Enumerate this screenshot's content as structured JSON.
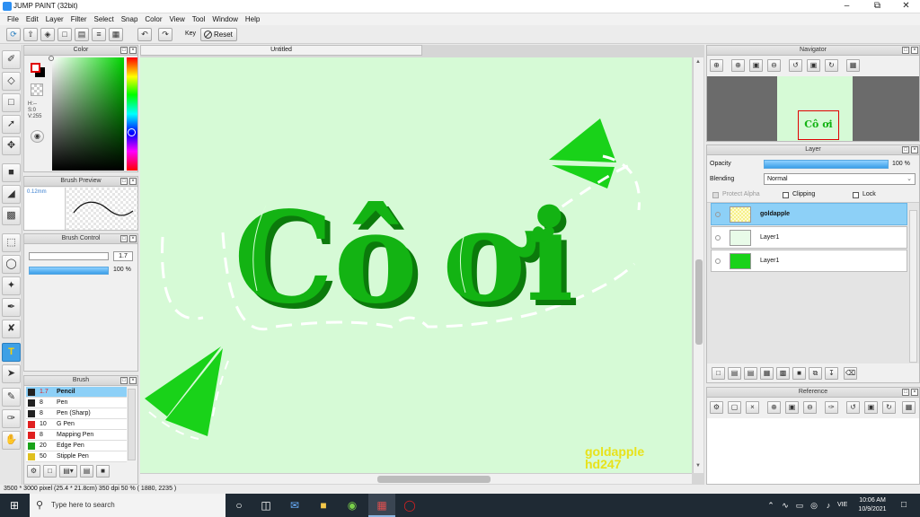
{
  "app": {
    "title": "JUMP PAINT (32bit)"
  },
  "menu": [
    "File",
    "Edit",
    "Layer",
    "Filter",
    "Select",
    "Snap",
    "Color",
    "View",
    "Tool",
    "Window",
    "Help"
  ],
  "toolbar": {
    "key_label": "Key",
    "reset_label": "Reset"
  },
  "color_panel": {
    "title": "Color",
    "hsv_h": "H:--",
    "hsv_s": "S:0",
    "hsv_v": "V:255",
    "fg_color": "#ffffff",
    "bg_color": "#000000"
  },
  "brush_preview": {
    "title": "Brush Preview",
    "size_text": "0.12mm"
  },
  "brush_control": {
    "title": "Brush Control",
    "size_value": "1.7",
    "opacity_value": "100 %"
  },
  "brush_panel": {
    "title": "Brush",
    "items": [
      {
        "size": "1.7",
        "name": "Pencil",
        "color": "#222222"
      },
      {
        "size": "8",
        "name": "Pen",
        "color": "#222222"
      },
      {
        "size": "8",
        "name": "Pen (Sharp)",
        "color": "#222222"
      },
      {
        "size": "10",
        "name": "G Pen",
        "color": "#e02020"
      },
      {
        "size": "8",
        "name": "Mapping Pen",
        "color": "#e02020"
      },
      {
        "size": "20",
        "name": "Edge Pen",
        "color": "#1aa31a"
      },
      {
        "size": "50",
        "name": "Stipple Pen",
        "color": "#e0c020"
      }
    ]
  },
  "document": {
    "tab_title": "Untitled",
    "art_text_1": "Cô",
    "art_text_2": "ơi",
    "watermark_line1": "goldapple",
    "watermark_line2": "hd247"
  },
  "navigator": {
    "title": "Navigator",
    "thumb_text": "Cô ơi"
  },
  "layer_panel": {
    "title": "Layer",
    "opacity_label": "Opacity",
    "opacity_value": "100 %",
    "opacity_fraction": 1.0,
    "blending_label": "Blending",
    "blending_value": "Normal",
    "protect_alpha_label": "Protect Alpha",
    "clipping_label": "Clipping",
    "lock_label": "Lock",
    "layers": [
      {
        "name": "goldapple",
        "selected": true
      },
      {
        "name": "Layer1",
        "selected": false
      },
      {
        "name": "Layer1",
        "selected": false
      }
    ]
  },
  "reference": {
    "title": "Reference"
  },
  "status_bar": {
    "text": "3500 * 3000 pixel   (25.4 * 21.8cm)   350 dpi   50 %   ( 1880, 2235 )"
  },
  "taskbar": {
    "search_placeholder": "Type here to search",
    "language": "VIE",
    "time": "10:06 AM",
    "date": "10/9/2021"
  }
}
